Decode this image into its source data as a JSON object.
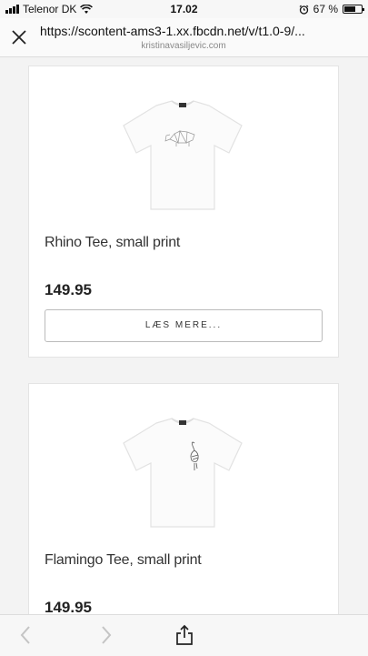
{
  "status": {
    "carrier": "Telenor DK",
    "time": "17.02",
    "battery": "67 %",
    "battery_level": 0.67
  },
  "browser": {
    "url": "https://scontent-ams3-1.xx.fbcdn.net/v/t1.0-9/...",
    "domain": "kristinavasiljevic.com"
  },
  "products": [
    {
      "name": "Rhino Tee, small print",
      "price": "149.95",
      "button": "LÆS MERE..."
    },
    {
      "name": "Flamingo Tee, small print",
      "price": "149.95"
    }
  ],
  "icons": {
    "close": "close-icon",
    "back": "chevron-left-icon",
    "forward": "chevron-right-icon",
    "share": "share-icon"
  }
}
